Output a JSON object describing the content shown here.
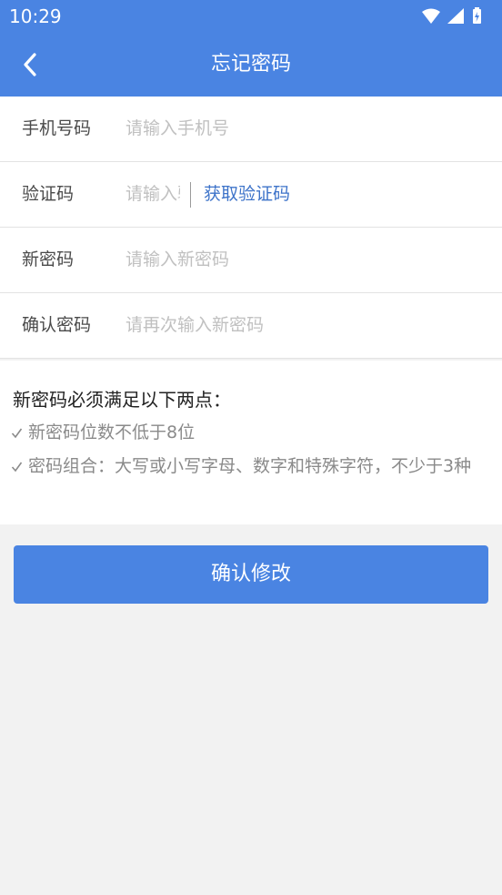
{
  "status_bar": {
    "time": "10:29"
  },
  "header": {
    "title": "忘记密码"
  },
  "form": {
    "rows": [
      {
        "label": "手机号码",
        "placeholder": "请输入手机号"
      },
      {
        "label": "验证码",
        "placeholder": "请输入验证码",
        "action": "获取验证码"
      },
      {
        "label": "新密码",
        "placeholder": "请输入新密码"
      },
      {
        "label": "确认密码",
        "placeholder": "请再次输入新密码"
      }
    ]
  },
  "rules": {
    "title": "新密码必须满足以下两点：",
    "items": [
      "新密码位数不低于8位",
      "密码组合：大写或小写字母、数字和特殊字符，不少于3种"
    ]
  },
  "confirm_button": {
    "label": "确认修改"
  },
  "colors": {
    "primary": "#4a84e2",
    "link": "#3d73c9",
    "background": "#f2f2f2"
  },
  "icons": {
    "back": "chevron-left-icon",
    "wifi": "wifi-icon",
    "signal": "cell-signal-icon",
    "battery": "battery-charging-icon",
    "check": "check-icon"
  }
}
